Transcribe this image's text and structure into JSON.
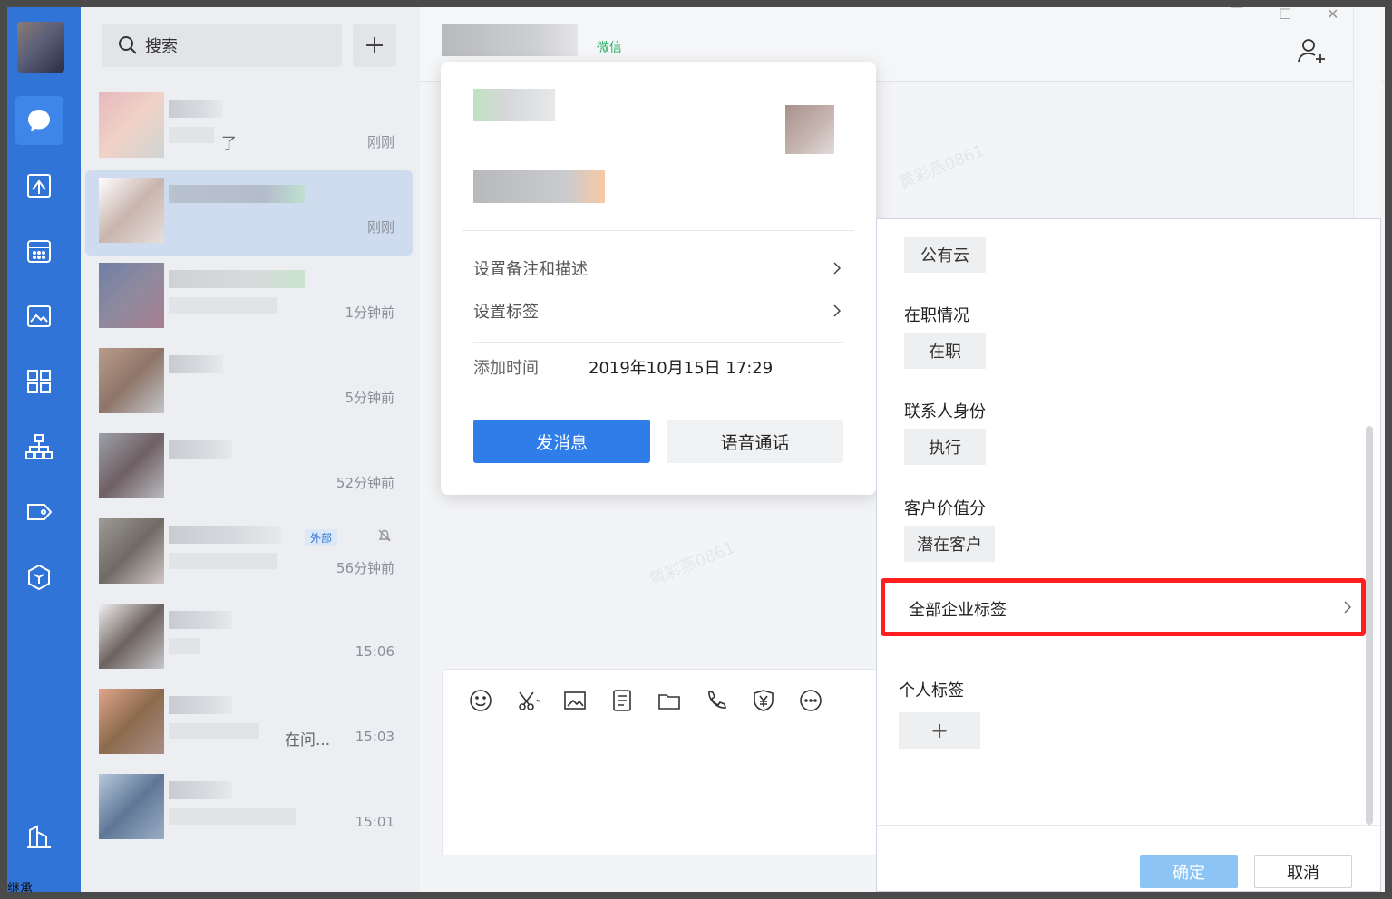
{
  "rail": {
    "items": [
      {
        "name": "messages",
        "active": true
      },
      {
        "name": "workbench"
      },
      {
        "name": "calendar"
      },
      {
        "name": "gallery"
      },
      {
        "name": "apps"
      },
      {
        "name": "organization"
      },
      {
        "name": "tag"
      },
      {
        "name": "package"
      },
      {
        "name": "buildings"
      }
    ]
  },
  "search": {
    "placeholder": "搜索"
  },
  "chats": [
    {
      "preview": "了",
      "time": "刚刚"
    },
    {
      "time": "刚刚",
      "active": true
    },
    {
      "time": "1分钟前"
    },
    {
      "time": "5分钟前"
    },
    {
      "time": "52分钟前"
    },
    {
      "time": "56分钟前",
      "badge": "外部",
      "muted": true
    },
    {
      "time": "15:06"
    },
    {
      "time": "15:03",
      "preview": "在问..."
    },
    {
      "time": "15:01"
    }
  ],
  "header": {
    "wechat_tag": "微信"
  },
  "card": {
    "row_remark": "设置备注和描述",
    "row_tags": "设置标签",
    "added_label": "添加时间",
    "added_value": "2019年10月15日 17:29",
    "btn_message": "发消息",
    "btn_voice": "语音通话"
  },
  "tag_panel": {
    "top_chip": "公有云",
    "sections": [
      {
        "title": "在职情况",
        "chip": "在职"
      },
      {
        "title": "联系人身份",
        "chip": "执行"
      },
      {
        "title": "客户价值分",
        "chip": "潜在客户"
      }
    ],
    "all_tags": "全部企业标签",
    "personal_title": "个人标签",
    "add_symbol": "+",
    "confirm": "确定",
    "cancel": "取消"
  },
  "watermark": "黄彩燕0861",
  "bottom_hint": "继承",
  "colors": {
    "rail": "#2f74d6",
    "primary": "#2f7de9",
    "highlight": "#ff1f1f"
  }
}
